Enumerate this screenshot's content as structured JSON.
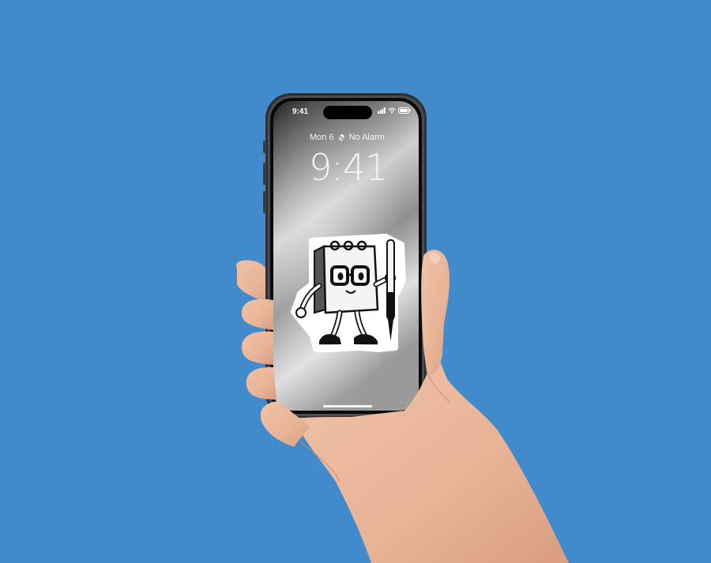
{
  "scene": {
    "background_color": "#418acc",
    "phone_frame_color": "#3a3c40",
    "screen_gradient": [
      "#1c1c1c",
      "#9a9a9a",
      "#dcdcdc",
      "#5a5a5a"
    ]
  },
  "lock_screen": {
    "status_time": "9:41",
    "status_icons": [
      "signal-icon",
      "wifi-icon",
      "battery-icon"
    ],
    "date": "Mon 6",
    "alarm_icon": "bell-slash-icon",
    "alarm_text": "No Alarm",
    "clock": "9:41"
  },
  "sticker": {
    "name": "notepad-mascot-with-pen"
  }
}
